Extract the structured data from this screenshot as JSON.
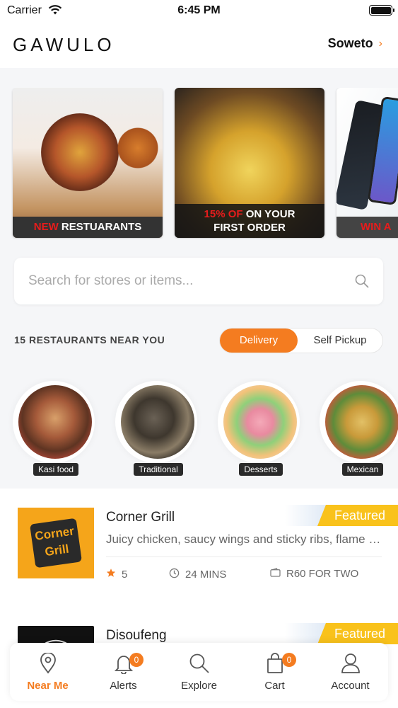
{
  "status_bar": {
    "carrier": "Carrier",
    "time": "6:45 PM"
  },
  "header": {
    "logo": "GAWULO",
    "location": "Soweto"
  },
  "banners": [
    {
      "highlight": "NEW",
      "text": "RESTUARANTS"
    },
    {
      "highlight": "15% OF",
      "text": "ON YOUR",
      "line2": "FIRST ORDER"
    },
    {
      "highlight": "WIN A"
    }
  ],
  "search": {
    "placeholder": "Search for stores or items..."
  },
  "nearby": {
    "count_text": "15 RESTAURANTS NEAR YOU"
  },
  "mode_toggle": {
    "options": [
      "Delivery",
      "Self Pickup"
    ],
    "selected": "Delivery"
  },
  "categories": [
    {
      "label": "Kasi food"
    },
    {
      "label": "Traditional"
    },
    {
      "label": "Desserts"
    },
    {
      "label": "Mexican"
    }
  ],
  "restaurants": [
    {
      "name": "Corner Grill",
      "description": "Juicy chicken, saucy wings and sticky ribs, flame grilled",
      "rating": "5",
      "time": "24 MINS",
      "price": "R60 FOR TWO",
      "badge": "Featured",
      "logo_text": "Corner Grill"
    },
    {
      "name": "Disoufeng",
      "badge": "Featured"
    }
  ],
  "bottom_nav": [
    {
      "label": "Near Me",
      "icon": "location-pin-icon",
      "active": true
    },
    {
      "label": "Alerts",
      "icon": "bell-icon",
      "badge": "0"
    },
    {
      "label": "Explore",
      "icon": "search-icon"
    },
    {
      "label": "Cart",
      "icon": "cart-icon",
      "badge": "0"
    },
    {
      "label": "Account",
      "icon": "user-icon"
    }
  ],
  "colors": {
    "accent": "#f47c20",
    "featured": "#f9c21b",
    "banner_highlight": "#e61c1c"
  }
}
